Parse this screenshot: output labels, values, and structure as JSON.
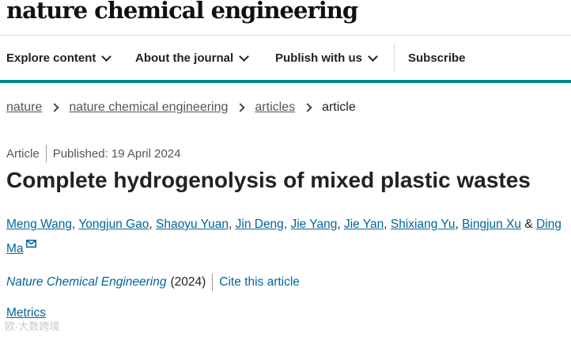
{
  "header": {
    "logo_text": "nature chemical engineering"
  },
  "nav": {
    "items": [
      {
        "label": "Explore content"
      },
      {
        "label": "About the journal"
      },
      {
        "label": "Publish with us"
      }
    ],
    "subscribe_label": "Subscribe"
  },
  "breadcrumb": {
    "items": [
      "nature",
      "nature chemical engineering",
      "articles"
    ],
    "current": "article"
  },
  "article": {
    "type": "Article",
    "published": "Published: 19 April 2024",
    "title": "Complete hydrogenolysis of mixed plastic wastes",
    "authors": [
      "Meng Wang",
      "Yongjun Gao",
      "Shaoyu Yuan",
      "Jin Deng",
      "Jie Yang",
      "Jie Yan",
      "Shixiang Yu",
      "Bingjun Xu",
      "Ding Ma"
    ],
    "author_separator": ",",
    "last_separator": "&",
    "journal": "Nature Chemical Engineering",
    "year": "(2024)",
    "cite_label": "Cite this article",
    "metrics_label": "Metrics"
  },
  "watermark": {
    "text": "欧·大数跨境"
  },
  "colors": {
    "accent_teal": "#00868b",
    "link": "#006699"
  }
}
